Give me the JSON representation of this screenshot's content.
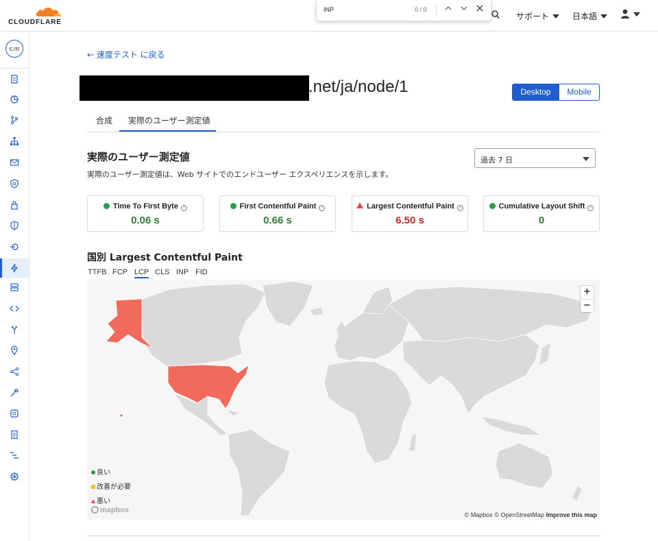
{
  "brand": {
    "name": "CLOUDFLARE",
    "accent": "#f38020"
  },
  "topbar": {
    "support": "サポート",
    "language": "日本語"
  },
  "findbar": {
    "query": "INP",
    "count": "0 / 0"
  },
  "account": {
    "initials": "c.m"
  },
  "sidebar": {
    "items": [
      {
        "icon": "clipboard-icon"
      },
      {
        "icon": "pie-chart-icon"
      },
      {
        "icon": "git-branch-icon"
      },
      {
        "icon": "network-icon"
      },
      {
        "icon": "mail-icon"
      },
      {
        "icon": "shield-badge-icon"
      },
      {
        "icon": "lock-icon"
      },
      {
        "icon": "shield-icon"
      },
      {
        "icon": "traffic-icon"
      },
      {
        "icon": "lightning-icon",
        "active": true
      },
      {
        "icon": "storage-icon"
      },
      {
        "icon": "code-icon"
      },
      {
        "icon": "filter-icon"
      },
      {
        "icon": "location-pin-icon"
      },
      {
        "icon": "share-icon"
      },
      {
        "icon": "wrench-icon"
      },
      {
        "icon": "app-icon"
      },
      {
        "icon": "document-icon"
      },
      {
        "icon": "list-icon"
      },
      {
        "icon": "snowflake-icon"
      }
    ]
  },
  "page": {
    "back_link": "← 速度テスト に戻る",
    "url_suffix": ".net/ja/node/1",
    "device_toggle": {
      "desktop": "Desktop",
      "mobile": "Mobile",
      "selected": "Desktop"
    },
    "tabs": [
      "合成",
      "実際のユーザー測定値"
    ],
    "active_tab": "実際のユーザー測定値"
  },
  "rum": {
    "title": "実際のユーザー測定値",
    "description": "実際のユーザー測定値は、Web サイトでのエンドユーザー エクスペリエンスを示します。",
    "period": "過去 7 日",
    "metrics": [
      {
        "name": "Time To First Byte",
        "value": "0.06 s",
        "status": "good",
        "color": "#2e7d32"
      },
      {
        "name": "First Contentful Paint",
        "value": "0.66 s",
        "status": "good",
        "color": "#2e7d32"
      },
      {
        "name": "Largest Contentful Paint",
        "value": "6.50 s",
        "status": "poor",
        "color": "#c62828"
      },
      {
        "name": "Cumulative Layout Shift",
        "value": "0",
        "status": "good",
        "color": "#2e7d32"
      }
    ]
  },
  "map": {
    "title": "国別 Largest Contentful Paint",
    "metric_tabs": [
      "TTFB",
      "FCP",
      "LCP",
      "CLS",
      "INP",
      "FID"
    ],
    "selected_metric": "LCP",
    "highlighted_countries": [
      {
        "country": "United States",
        "status": "poor"
      }
    ],
    "legend": {
      "good": "良い",
      "needs_improvement": "改善が必要",
      "poor": "悪い"
    },
    "zoom_in": "+",
    "zoom_out": "−",
    "logo": "mapbox",
    "attribution": "© Mapbox © OpenStreetMap",
    "improve_link": "Improve this map",
    "colors": {
      "land": "#dadada",
      "poor": "#f26a5c",
      "good": "#2e9b47",
      "needs_improvement": "#f4c430"
    }
  }
}
